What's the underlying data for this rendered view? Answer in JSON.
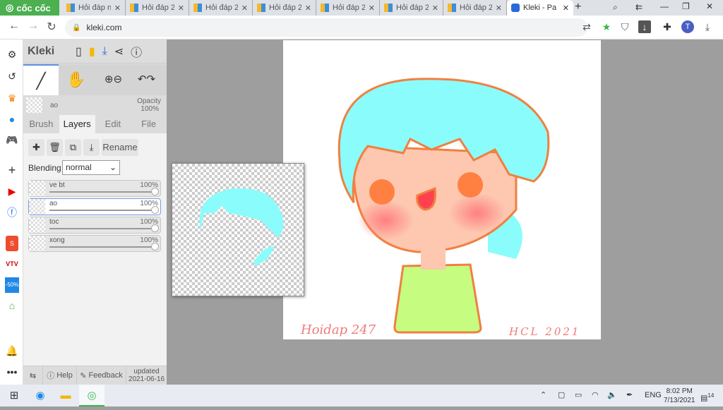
{
  "browser": {
    "brand": "cốc cốc",
    "url": "kleki.com",
    "tabs": [
      {
        "title": "Hỏi đáp n",
        "icon": "hoidap-icon"
      },
      {
        "title": "Hỏi đáp 2",
        "icon": "hoidap-icon"
      },
      {
        "title": "Hỏi đáp 2",
        "icon": "hoidap-icon"
      },
      {
        "title": "Hỏi đáp 2",
        "icon": "hoidap-icon"
      },
      {
        "title": "Hỏi đáp 2",
        "icon": "hoidap-icon"
      },
      {
        "title": "Hỏi đáp 2",
        "icon": "hoidap-icon"
      },
      {
        "title": "Hỏi đáp 2",
        "icon": "hoidap-icon"
      },
      {
        "title": "Kleki - Pa",
        "icon": "kleki-icon",
        "active": true
      }
    ],
    "profile_initial": "T"
  },
  "app": {
    "logo": "Kleki",
    "layer_info": {
      "name": "ao",
      "opacity_label": "Opacity",
      "opacity": "100%"
    },
    "tabs": [
      "Brush",
      "Layers",
      "Edit",
      "File"
    ],
    "active_tab": "Layers",
    "rename": "Rename",
    "blending_label": "Blending",
    "blending_value": "normal",
    "layers": [
      {
        "name": "ve bt",
        "opacity": "100%"
      },
      {
        "name": "ao",
        "opacity": "100%",
        "selected": true
      },
      {
        "name": "toc",
        "opacity": "100%"
      },
      {
        "name": "xong",
        "opacity": "100%"
      }
    ],
    "footer": {
      "help": "Help",
      "feedback": "Feedback",
      "updated": "updated",
      "date": "2021-06-16"
    }
  },
  "artwork": {
    "signature_left": "Hoidap 247",
    "signature_right": "HCL 2021",
    "colors": {
      "hair": "#8afcfc",
      "outline": "#f08040",
      "skin": "#fdc7b0",
      "shirt": "#c6fc80",
      "cheek": "#ff7f7f"
    }
  },
  "taskbar": {
    "lang": "ENG",
    "time": "8:02 PM",
    "date": "7/13/2021",
    "notifications": "14"
  }
}
